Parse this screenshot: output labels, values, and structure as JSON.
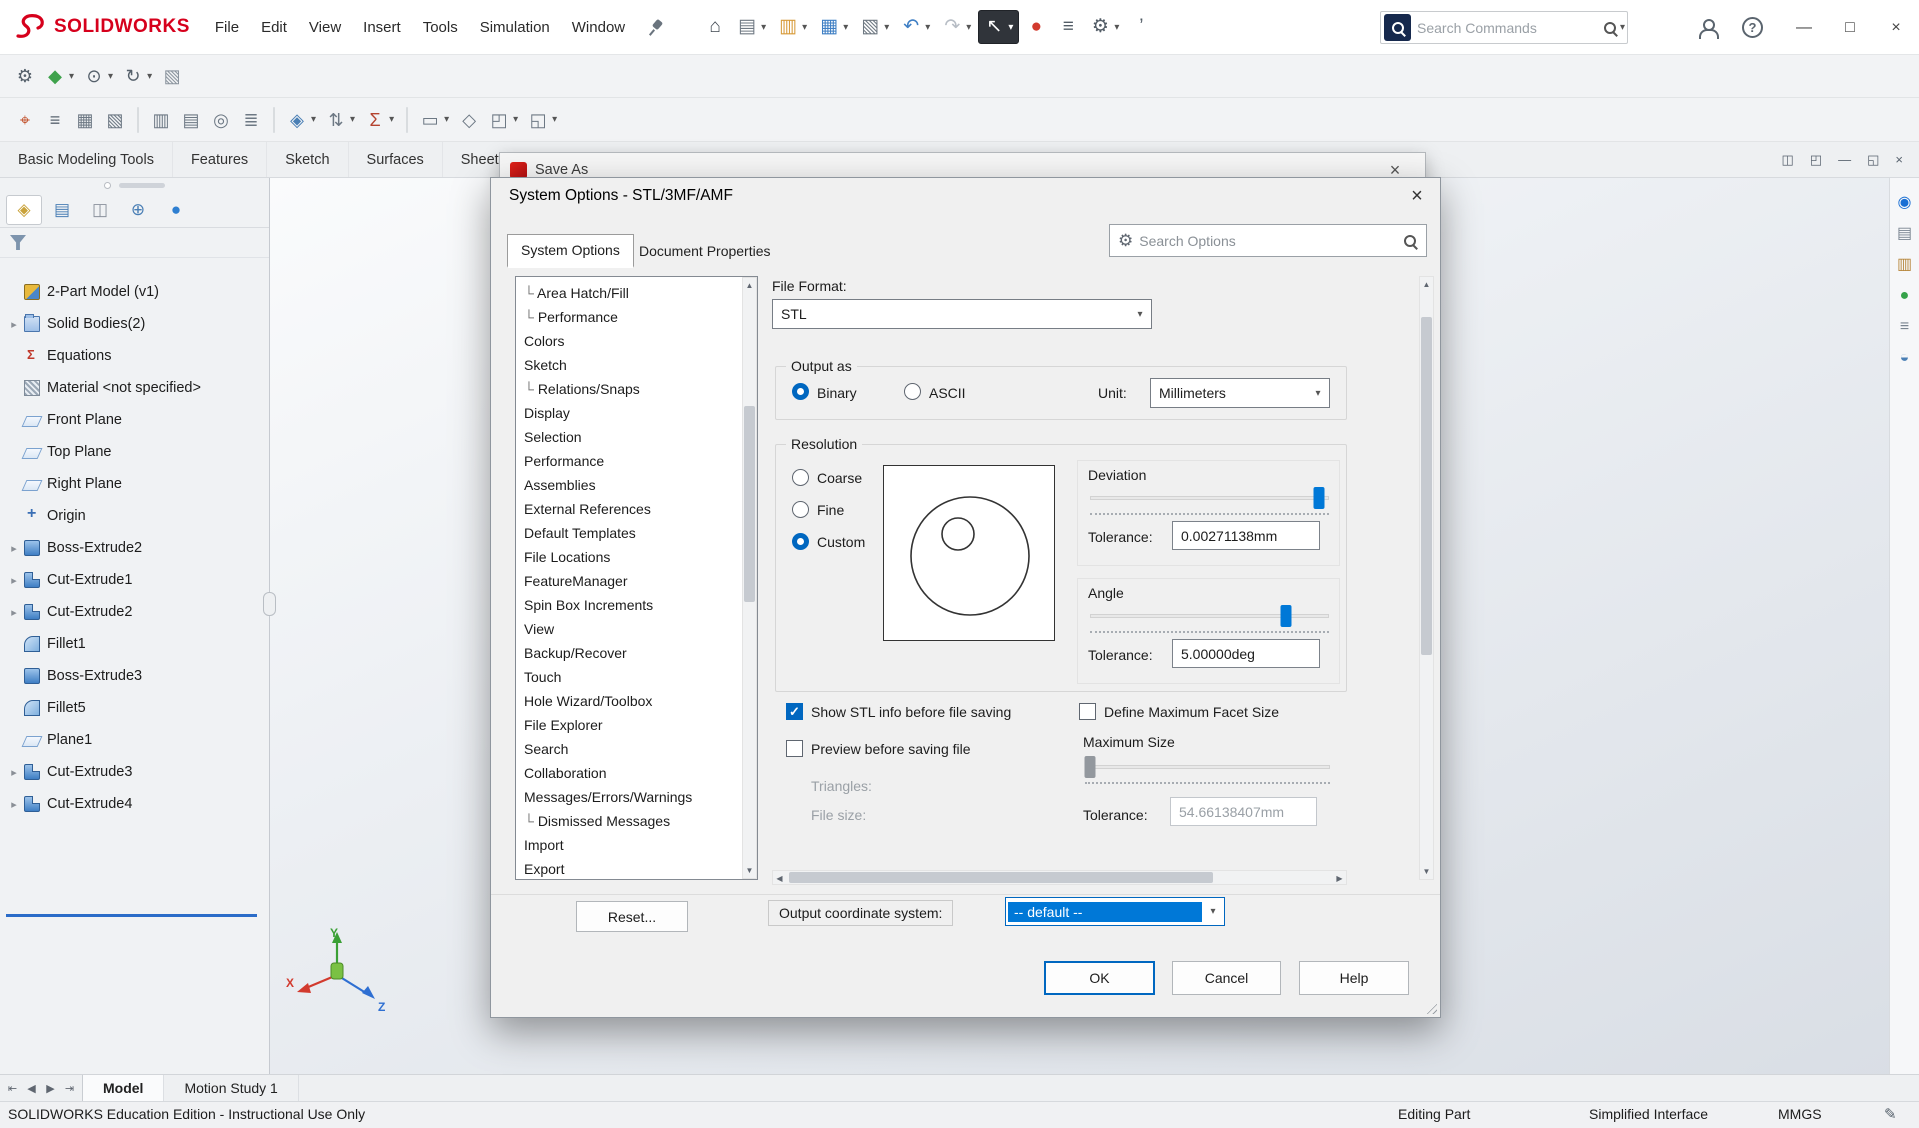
{
  "titlebar": {
    "brand": "SOLIDWORKS",
    "menus": [
      {
        "label": "File"
      },
      {
        "label": "Edit"
      },
      {
        "label": "View"
      },
      {
        "label": "Insert"
      },
      {
        "label": "Tools"
      },
      {
        "label": "Simulation"
      },
      {
        "label": "Window"
      }
    ],
    "tools": [
      {
        "name": "home-icon",
        "glyph": "⌂",
        "color": "#3f4750"
      },
      {
        "name": "new-file-icon",
        "glyph": "▤",
        "color": "#6f7983",
        "dd": true
      },
      {
        "name": "open-file-icon",
        "glyph": "▥",
        "color": "#d79b3a",
        "dd": true
      },
      {
        "name": "save-icon",
        "glyph": "▦",
        "color": "#3f7fc4",
        "dd": true
      },
      {
        "name": "print-icon",
        "glyph": "▧",
        "color": "#6f7983",
        "dd": true
      },
      {
        "name": "undo-icon",
        "glyph": "↶",
        "color": "#3f7fc4",
        "dd": true
      },
      {
        "name": "redo-icon",
        "glyph": "↷",
        "color": "#b7bdc5",
        "dd": true
      },
      {
        "name": "select-cursor-icon",
        "glyph": "↖",
        "color": "#ffffff",
        "cls": "dark",
        "dd": true
      },
      {
        "name": "abort-command-icon",
        "glyph": "●",
        "color": "#d23a2e"
      },
      {
        "name": "command-manager-icon",
        "glyph": "≡",
        "color": "#525c66"
      },
      {
        "name": "options-gear-icon",
        "glyph": "⚙",
        "color": "#525c66",
        "dd": true
      },
      {
        "name": "toolbar-overflow-icon",
        "glyph": "’",
        "color": "#525c66"
      }
    ],
    "search": {
      "placeholder": "Search Commands"
    },
    "window_controls": [
      {
        "name": "minimize-window-icon",
        "glyph": "—"
      },
      {
        "name": "maximize-window-icon",
        "glyph": "□"
      },
      {
        "name": "close-window-icon",
        "glyph": "×"
      }
    ]
  },
  "toolbar2": {
    "items": [
      {
        "name": "tool-settings-gears-icon",
        "glyph": "⚙",
        "color": "#55606b"
      },
      {
        "name": "apply-scene-icon",
        "glyph": "◆",
        "color": "#3fa24c",
        "dd": true
      },
      {
        "name": "hide-show-items-icon",
        "glyph": "⊙",
        "color": "#55606b",
        "dd": true
      },
      {
        "name": "view-orientation-icon",
        "glyph": "↻",
        "color": "#55606b",
        "dd": true
      },
      {
        "name": "display-style-icon",
        "glyph": "▧",
        "color": "#8b949e"
      }
    ]
  },
  "toolbar3": {
    "items": [
      {
        "name": "measure-icon",
        "glyph": "⌖",
        "color": "#c2512c"
      },
      {
        "name": "mass-properties-icon",
        "glyph": "≡",
        "color": "#5a6470"
      },
      {
        "name": "interference-detection-icon",
        "glyph": "▦",
        "color": "#6d7884"
      },
      {
        "name": "clearance-verification-icon",
        "glyph": "▧",
        "color": "#6d7884"
      },
      {
        "cls": "sep"
      },
      {
        "name": "section-properties-icon",
        "glyph": "▥",
        "color": "#6d7884"
      },
      {
        "name": "performance-evaluation-icon",
        "glyph": "▤",
        "color": "#6d7884"
      },
      {
        "name": "sensor-icon",
        "glyph": "◎",
        "color": "#6d7884"
      },
      {
        "name": "design-statistics-icon",
        "glyph": "≣",
        "color": "#6d7884"
      },
      {
        "cls": "sep"
      },
      {
        "name": "exploded-view-icon",
        "glyph": "◈",
        "color": "#4a7fb5",
        "dd": true
      },
      {
        "name": "reorder-features-icon",
        "glyph": "⇅",
        "color": "#6d7884",
        "dd": true
      },
      {
        "name": "equations-tool-icon",
        "glyph": "Σ",
        "color": "#b5432f",
        "dd": true
      },
      {
        "cls": "sep"
      },
      {
        "name": "format-options-icon",
        "glyph": "▭",
        "color": "#6d7884",
        "dd": true
      },
      {
        "name": "surface-tool-icon",
        "glyph": "◇",
        "color": "#6d7884"
      },
      {
        "name": "shell-tool-icon",
        "glyph": "◰",
        "color": "#6d7884",
        "dd": true
      },
      {
        "name": "structure-system-icon",
        "glyph": "◱",
        "color": "#6d7884",
        "dd": true
      }
    ]
  },
  "ribbon": {
    "tabs": [
      {
        "label": "Basic Modeling Tools"
      },
      {
        "label": "Features"
      },
      {
        "label": "Sketch"
      },
      {
        "label": "Surfaces"
      },
      {
        "label": "Sheet Metal"
      }
    ],
    "doc_controls": [
      {
        "name": "pane-split-icon",
        "glyph": "◫"
      },
      {
        "name": "pane-restore-icon",
        "glyph": "◰"
      },
      {
        "name": "doc-minimize-icon",
        "glyph": "—"
      },
      {
        "name": "doc-restore-icon",
        "glyph": "◱"
      },
      {
        "name": "doc-close-icon",
        "glyph": "×"
      }
    ]
  },
  "feature_panel": {
    "tabs": [
      {
        "name": "featuremanager-tree-tab",
        "glyph": "◈",
        "color": "#c9a23a",
        "cls": "active"
      },
      {
        "name": "propertymanager-tab",
        "glyph": "▤",
        "color": "#4a7fb5"
      },
      {
        "name": "configurationmanager-tab",
        "glyph": "◫",
        "color": "#8a929c"
      },
      {
        "name": "dimxpertmanager-tab",
        "glyph": "⊕",
        "color": "#4a7fb5"
      },
      {
        "name": "displaymanager-tab",
        "glyph": "●",
        "color": "#2e7fd1"
      }
    ],
    "root": {
      "label": "2-Part Model (v1)",
      "icon": "part"
    },
    "items": [
      {
        "label": "Solid Bodies(2)",
        "icon": "bodies",
        "arrow": "▸"
      },
      {
        "label": "Equations",
        "icon": "equations"
      },
      {
        "label": "Material <not specified>",
        "icon": "material"
      },
      {
        "label": "Front Plane",
        "icon": "plane"
      },
      {
        "label": "Top Plane",
        "icon": "plane"
      },
      {
        "label": "Right Plane",
        "icon": "plane"
      },
      {
        "label": "Origin",
        "icon": "origin"
      },
      {
        "label": "Boss-Extrude2",
        "icon": "boss",
        "arrow": "▸"
      },
      {
        "label": "Cut-Extrude1",
        "icon": "cut",
        "arrow": "▸"
      },
      {
        "label": "Cut-Extrude2",
        "icon": "cut",
        "arrow": "▸"
      },
      {
        "label": "Fillet1",
        "icon": "fillet"
      },
      {
        "label": "Boss-Extrude3",
        "icon": "boss"
      },
      {
        "label": "Fillet5",
        "icon": "fillet"
      },
      {
        "label": "Plane1",
        "icon": "plane"
      },
      {
        "label": "Cut-Extrude3",
        "icon": "cut",
        "arrow": "▸"
      },
      {
        "label": "Cut-Extrude4",
        "icon": "cut",
        "arrow": "▸"
      }
    ]
  },
  "canvas": {
    "triad": {
      "x": "X",
      "y": "Y",
      "z": "Z"
    }
  },
  "task_pane": {
    "icons": [
      {
        "name": "threedexperience-icon",
        "glyph": "◉",
        "color": "#1a6fd4"
      },
      {
        "name": "design-library-icon",
        "glyph": "▤",
        "color": "#7a8591"
      },
      {
        "name": "file-explorer-icon",
        "glyph": "▥",
        "color": "#b7873d"
      },
      {
        "name": "appearances-icon",
        "glyph": "●",
        "color": "#35a24a"
      },
      {
        "name": "custom-properties-icon",
        "glyph": "≡",
        "color": "#7a8591"
      },
      {
        "name": "forum-icon",
        "glyph": "◒",
        "color": "#4a7fb5"
      }
    ]
  },
  "save_as": {
    "title": "Save As"
  },
  "dialog": {
    "title": "System Options - STL/3MF/AMF",
    "tabs": [
      {
        "label": "System Options",
        "cls": "active"
      },
      {
        "label": "Document Properties"
      }
    ],
    "search_placeholder": "Search Options",
    "tree": [
      {
        "pre": "└",
        "label": "Area Hatch/Fill"
      },
      {
        "pre": "└",
        "label": "Performance"
      },
      {
        "label": "Colors"
      },
      {
        "label": "Sketch"
      },
      {
        "pre": "└",
        "label": "Relations/Snaps"
      },
      {
        "label": "Display"
      },
      {
        "label": "Selection"
      },
      {
        "label": "Performance"
      },
      {
        "label": "Assemblies"
      },
      {
        "label": "External References"
      },
      {
        "label": "Default Templates"
      },
      {
        "label": "File Locations"
      },
      {
        "label": "FeatureManager"
      },
      {
        "label": "Spin Box Increments"
      },
      {
        "label": "View"
      },
      {
        "label": "Backup/Recover"
      },
      {
        "label": "Touch"
      },
      {
        "label": "Hole Wizard/Toolbox"
      },
      {
        "label": "File Explorer"
      },
      {
        "label": "Search"
      },
      {
        "label": "Collaboration"
      },
      {
        "label": "Messages/Errors/Warnings"
      },
      {
        "pre": "└",
        "label": "Dismissed Messages"
      },
      {
        "label": "Import"
      },
      {
        "label": "Export"
      }
    ],
    "file_format": {
      "label": "File Format:",
      "value": "STL"
    },
    "output_as": {
      "title": "Output as",
      "binary_label": "Binary",
      "binary_selected": true,
      "ascii_label": "ASCII",
      "ascii_selected": false,
      "unit_label": "Unit:",
      "unit_value": "Millimeters"
    },
    "resolution": {
      "title": "Resolution",
      "coarse_label": "Coarse",
      "coarse_selected": false,
      "fine_label": "Fine",
      "fine_selected": false,
      "custom_label": "Custom",
      "custom_selected": true,
      "deviation": {
        "title": "Deviation",
        "tolerance_label": "Tolerance:",
        "tolerance_value": "0.00271138mm",
        "slider_pct": 96
      },
      "angle": {
        "title": "Angle",
        "tolerance_label": "Tolerance:",
        "tolerance_value": "5.00000deg",
        "slider_pct": 82
      }
    },
    "checkboxes": {
      "show_stl": {
        "label": "Show STL info before file saving",
        "checked": true
      },
      "define_max": {
        "label": "Define Maximum Facet Size",
        "checked": false
      },
      "preview": {
        "label": "Preview before saving file",
        "checked": false
      }
    },
    "info": {
      "triangles": "Triangles:",
      "file_size": "File size:"
    },
    "max_size": {
      "title": "Maximum Size",
      "tolerance_label": "Tolerance:",
      "tolerance_value": "54.66138407mm",
      "slider_pct": 2
    },
    "output_cs": {
      "label": "Output coordinate system:",
      "value": "-- default --"
    },
    "buttons": {
      "reset": "Reset...",
      "ok": "OK",
      "cancel": "Cancel",
      "help": "Help"
    }
  },
  "bottom_tabs": {
    "nav": [
      {
        "name": "first-tab-icon",
        "glyph": "⇤"
      },
      {
        "name": "prev-tab-icon",
        "glyph": "◀"
      },
      {
        "name": "next-tab-icon",
        "glyph": "▶"
      },
      {
        "name": "last-tab-icon",
        "glyph": "⇥"
      }
    ],
    "items": [
      {
        "label": "Model",
        "cls": "active"
      },
      {
        "label": "Motion Study 1"
      }
    ]
  },
  "statusbar": {
    "left": "SOLIDWORKS Education Edition - Instructional Use Only",
    "editing": "Editing Part",
    "interface": "Simplified Interface",
    "units": "MMGS"
  },
  "colors": {
    "accent": "#0078d7",
    "brand": "#d6001c",
    "selection": "#0067c0"
  }
}
